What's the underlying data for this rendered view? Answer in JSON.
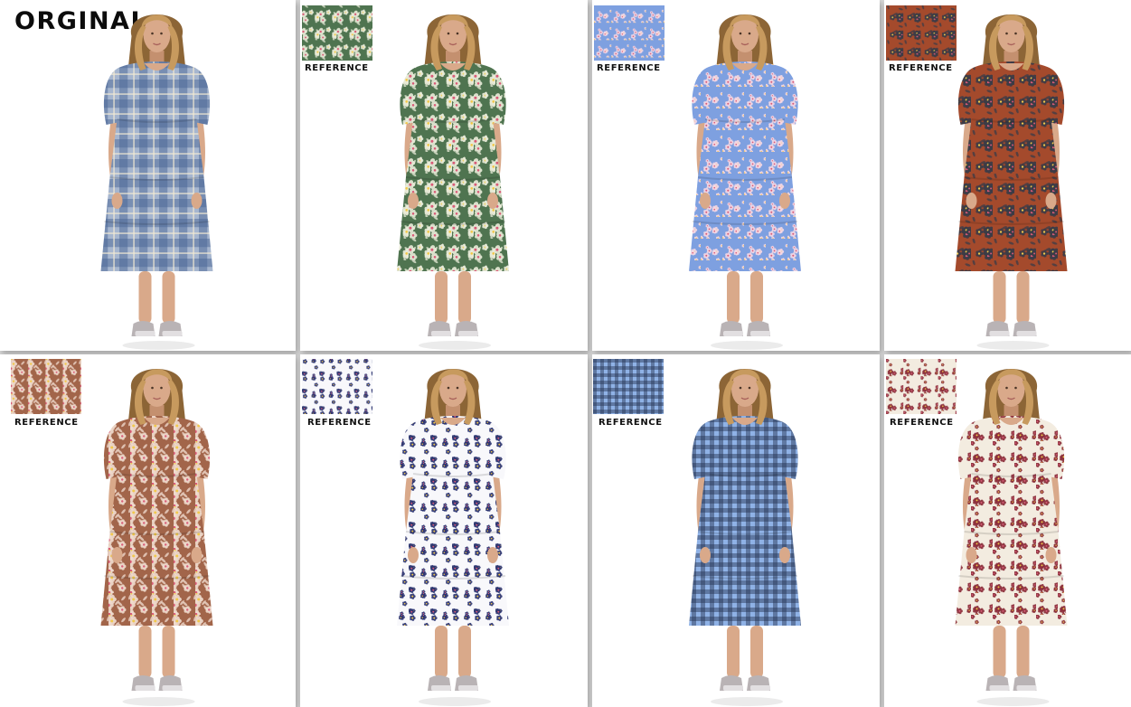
{
  "title": "ORGINAL",
  "reference_label": "REFERENCE",
  "panels": [
    {
      "id": "original",
      "pattern": "plaid",
      "dress_base": "#a6b6cf",
      "dress_accent": "#4a6596",
      "swatch": false
    },
    {
      "id": "green-floral",
      "pattern": "floral",
      "dress_base": "#4f7450",
      "dress_accent": "#e9ecd9",
      "swatch": true
    },
    {
      "id": "blue-ditsy",
      "pattern": "ditsy",
      "dress_base": "#7ea0e0",
      "dress_accent": "#f6d7e4",
      "swatch": true
    },
    {
      "id": "rust-floral",
      "pattern": "floral",
      "dress_base": "#a44a2c",
      "dress_accent": "#3a3b46",
      "swatch": true
    },
    {
      "id": "brown-blossom",
      "pattern": "floral",
      "dress_base": "#a2654a",
      "dress_accent": "#f1ddd0",
      "swatch": true
    },
    {
      "id": "white-ditsy",
      "pattern": "ditsy",
      "dress_base": "#f8f8fb",
      "dress_accent": "#2a3370",
      "swatch": true
    },
    {
      "id": "blue-gingham",
      "pattern": "gingham",
      "dress_base": "#8fb2e6",
      "dress_accent": "#24314f",
      "swatch": true
    },
    {
      "id": "cream-ditsy",
      "pattern": "ditsy",
      "dress_base": "#f3ece0",
      "dress_accent": "#8a2b38",
      "swatch": true
    }
  ]
}
